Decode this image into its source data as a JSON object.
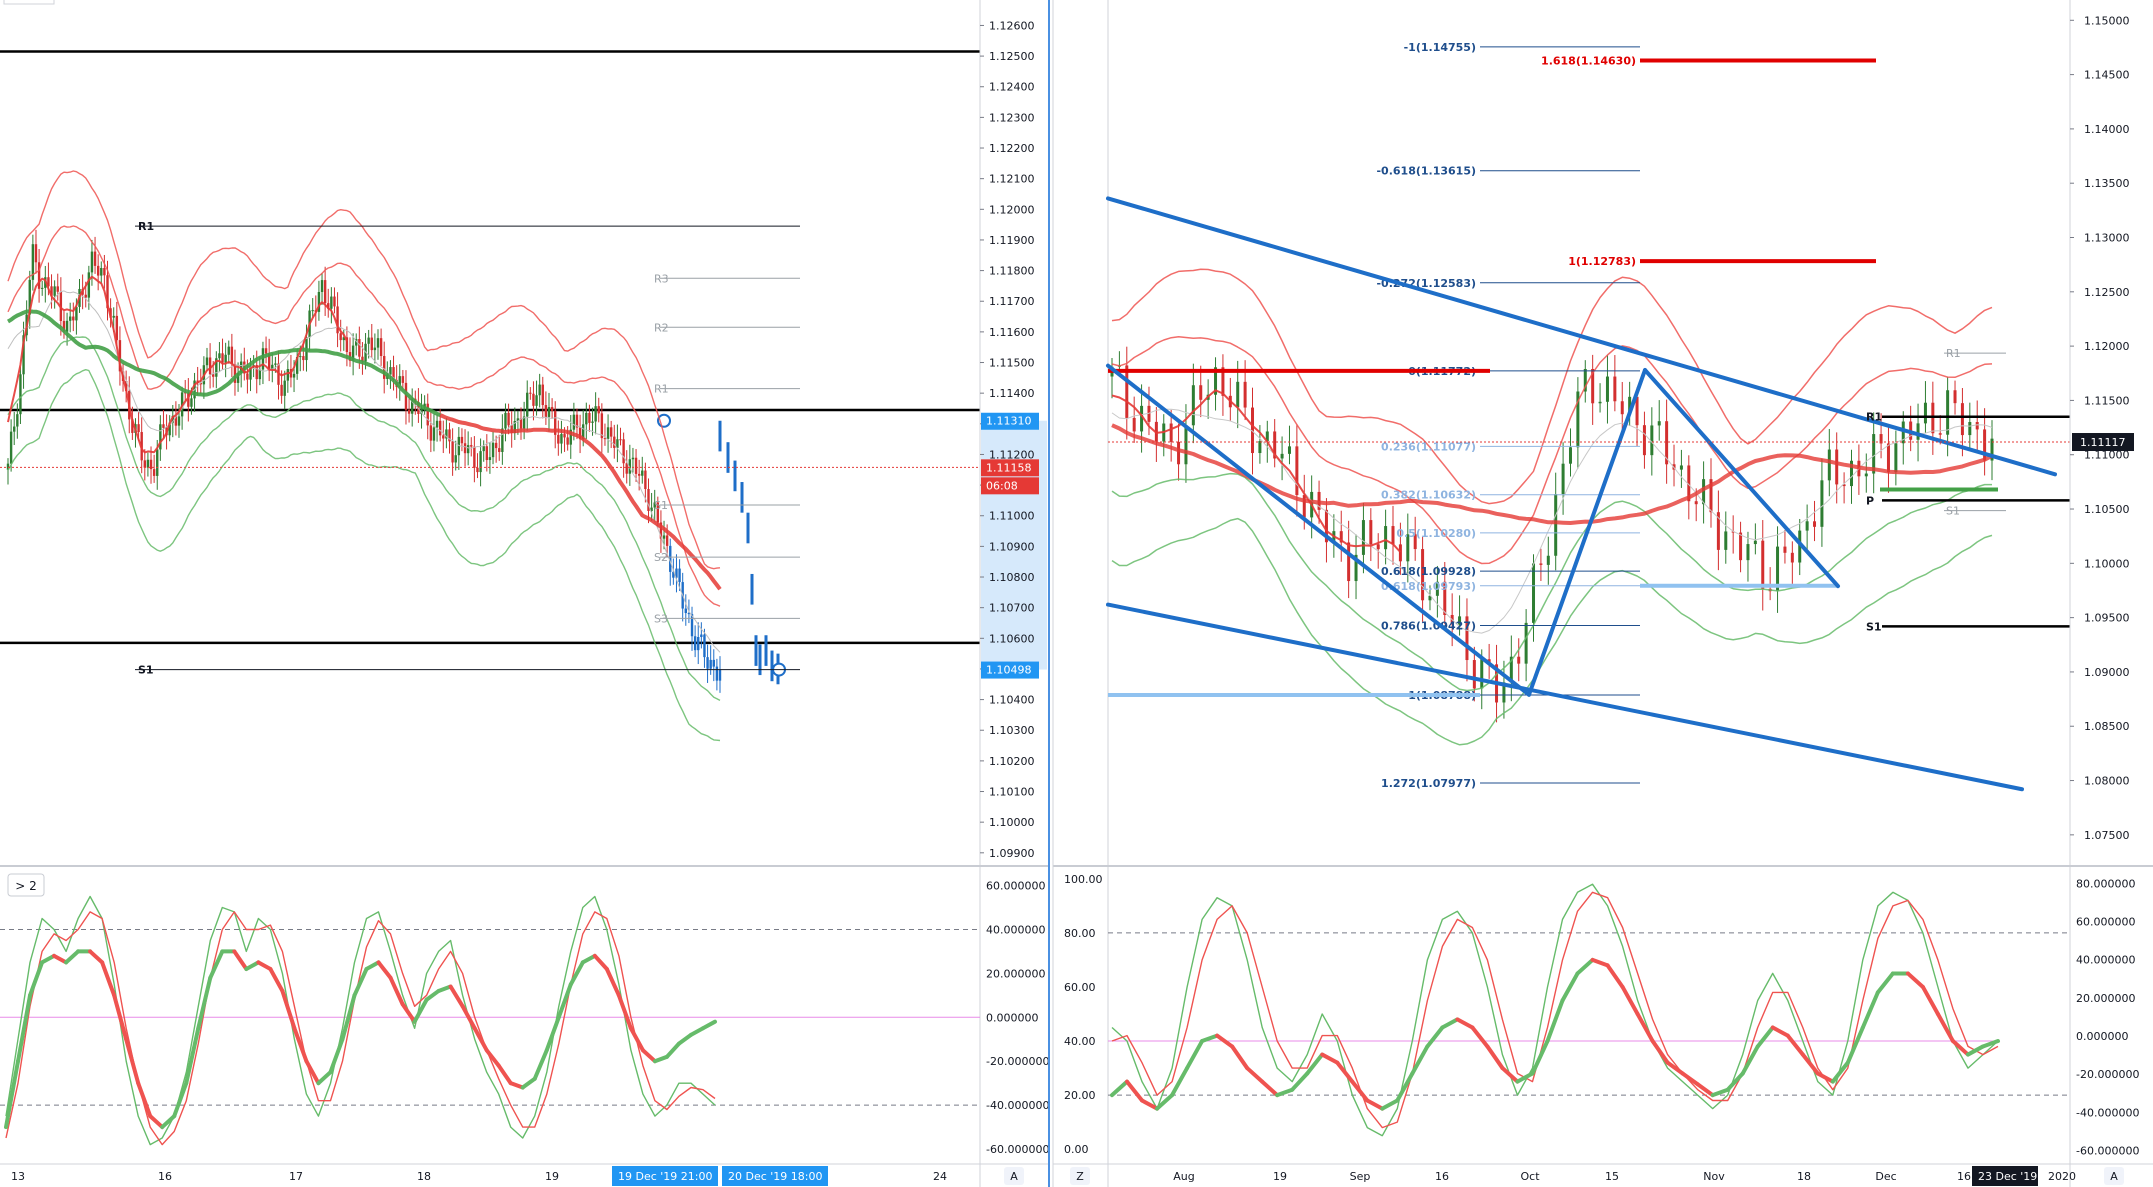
{
  "colors": {
    "up": "#2e7d32",
    "down": "#d32f2f",
    "bb_red": "#ef5350",
    "bb_green": "#66bb6a",
    "ma_red": "#e53935",
    "ma_green": "#43a047",
    "trend_blue": "#1e6ec8",
    "light_blue": "#90c2f0",
    "price_tag_blue": "#2196f3",
    "price_tag_red": "#e53935"
  },
  "left_chart": {
    "price_axis_ticks": [
      "1.12600",
      "1.12500",
      "1.12400",
      "1.12300",
      "1.12200",
      "1.12100",
      "1.12000",
      "1.11900",
      "1.11800",
      "1.11700",
      "1.11600",
      "1.11500",
      "1.11400",
      "1.11300",
      "1.11200",
      "1.11100",
      "1.11000",
      "1.10900",
      "1.10800",
      "1.10700",
      "1.10600",
      "1.10500",
      "1.10400",
      "1.10300",
      "1.10200",
      "1.10100",
      "1.10000",
      "1.09900"
    ],
    "price_tags": [
      {
        "text": "1.11310",
        "value": 1.1131,
        "color": "blue"
      },
      {
        "text": "1.11158",
        "value": 1.11158,
        "color": "red"
      },
      {
        "text": "06:08",
        "value": 1.11158,
        "color": "red"
      },
      {
        "text": "1.10498",
        "value": 1.10498,
        "color": "blue"
      }
    ],
    "time_labels": [
      "13",
      "16",
      "17",
      "18",
      "19",
      "24"
    ],
    "time_tags": [
      "19 Dec '19  21:00",
      "20 Dec '19  18:00"
    ],
    "pivots_bold": [
      {
        "label": "R1",
        "value": 1.11945
      },
      {
        "label": "S1",
        "value": 1.10498
      }
    ],
    "pivots_grey": [
      {
        "label": "R3",
        "value": 1.11775
      },
      {
        "label": "R2",
        "value": 1.11615
      },
      {
        "label": "R1",
        "value": 1.11415
      },
      {
        "label": "S1",
        "value": 1.11035
      },
      {
        "label": "S2",
        "value": 1.10865
      },
      {
        "label": "S3",
        "value": 1.10665
      }
    ],
    "horizontal_lines": [
      1.12515,
      1.11345,
      1.10585
    ],
    "corner_button": "A"
  },
  "left_oscillator": {
    "axis_ticks": [
      "60.000000",
      "40.000000",
      "20.000000",
      "0.000000",
      "-20.000000",
      "-40.000000",
      "-60.000000"
    ],
    "levels": [
      40,
      -40
    ],
    "zero_line": 0,
    "indicator_button": "> 2"
  },
  "right_chart": {
    "price_axis_ticks": [
      "1.15000",
      "1.14500",
      "1.14000",
      "1.13500",
      "1.13000",
      "1.12500",
      "1.12000",
      "1.11500",
      "1.11000",
      "1.10500",
      "1.10000",
      "1.09500",
      "1.09000",
      "1.08500",
      "1.08000",
      "1.07500"
    ],
    "price_tag": {
      "text": "1.11117",
      "value": 1.11117
    },
    "time_labels": [
      "Aug",
      "19",
      "Sep",
      "16",
      "Oct",
      "15",
      "Nov",
      "18",
      "Dec",
      "16",
      "2020"
    ],
    "time_tag": "23 Dec '19",
    "fib_levels": [
      {
        "label": "-1(1.14755)",
        "value": 1.14755,
        "style": "dark"
      },
      {
        "label": "1.618(1.14630)",
        "value": 1.1463,
        "style": "red"
      },
      {
        "label": "-0.618(1.13615)",
        "value": 1.13615,
        "style": "dark"
      },
      {
        "label": "1(1.12783)",
        "value": 1.12783,
        "style": "red"
      },
      {
        "label": "-0.272(1.12583)",
        "value": 1.12583,
        "style": "dark"
      },
      {
        "label": "0(1.11772)",
        "value": 1.11772,
        "style": "dark"
      },
      {
        "label": "0.236(1.11077)",
        "value": 1.11077,
        "style": "light"
      },
      {
        "label": "0.382(1.10632)",
        "value": 1.10632,
        "style": "light"
      },
      {
        "label": "0.5(1.10280)",
        "value": 1.1028,
        "style": "light"
      },
      {
        "label": "0.618(1.09928)",
        "value": 1.09928,
        "style": "dark"
      },
      {
        "label": "0.618(1.09793)",
        "value": 1.09793,
        "style": "light"
      },
      {
        "label": "0.786(1.09427)",
        "value": 1.09427,
        "style": "dark"
      },
      {
        "label": "1(1.08788)",
        "value": 1.08788,
        "style": "dark"
      },
      {
        "label": "1.272(1.07977)",
        "value": 1.07977,
        "style": "dark"
      }
    ],
    "pivots_bold": [
      {
        "label": "R1",
        "value": 1.1135
      },
      {
        "label": "P",
        "value": 1.1058
      },
      {
        "label": "S1",
        "value": 1.0942
      }
    ],
    "pivots_grey": [
      {
        "label": "R1",
        "value": 1.11935
      },
      {
        "label": "S1",
        "value": 1.10485
      }
    ],
    "corner_buttons": [
      "Z",
      "A"
    ]
  },
  "right_oscillator": {
    "left_axis_ticks": [
      "100.00",
      "80.00",
      "60.00",
      "40.00",
      "20.00",
      "0.00"
    ],
    "right_axis_ticks": [
      "80.000000",
      "60.000000",
      "40.000000",
      "20.000000",
      "0.000000",
      "-20.000000",
      "-40.000000",
      "-60.000000"
    ],
    "levels": [
      80,
      20
    ],
    "mid_line": 40
  },
  "chart_data": [
    {
      "type": "candlestick",
      "instrument_view": "left",
      "timeframe": "hourly",
      "ylim": [
        1.0987,
        1.1267
      ],
      "x_labels": [
        "13",
        "16",
        "17",
        "18",
        "19",
        "24"
      ],
      "price_path": [
        1.1115,
        1.1145,
        1.1185,
        1.1175,
        1.1172,
        1.116,
        1.1172,
        1.1182,
        1.1178,
        1.1155,
        1.1135,
        1.112,
        1.1115,
        1.113,
        1.1132,
        1.114,
        1.1145,
        1.115,
        1.1152,
        1.1148,
        1.1145,
        1.1152,
        1.1148,
        1.1142,
        1.115,
        1.1162,
        1.1176,
        1.1165,
        1.1155,
        1.1152,
        1.1158,
        1.115,
        1.1145,
        1.1138,
        1.1135,
        1.113,
        1.1126,
        1.1122,
        1.1122,
        1.1118,
        1.112,
        1.1128,
        1.113,
        1.1135,
        1.1142,
        1.113,
        1.1125,
        1.1128,
        1.1132,
        1.1131,
        1.1125,
        1.112,
        1.1115,
        1.1108,
        1.1095,
        1.1085,
        1.107,
        1.106,
        1.1052,
        1.105
      ],
      "last_price": 1.11158,
      "marked_high": 1.1131,
      "marked_low": 1.10498
    },
    {
      "type": "candlestick",
      "instrument_view": "right",
      "timeframe": "daily",
      "ylim": [
        1.0725,
        1.1515
      ],
      "x_labels": [
        "Aug",
        "19",
        "Sep",
        "16",
        "Oct",
        "15",
        "Nov",
        "18",
        "Dec",
        "16",
        "2020"
      ],
      "price_path": [
        1.1172,
        1.115,
        1.113,
        1.112,
        1.111,
        1.1125,
        1.1158,
        1.1172,
        1.1155,
        1.113,
        1.1115,
        1.1105,
        1.1085,
        1.1062,
        1.1035,
        1.102,
        1.1005,
        1.1015,
        1.103,
        1.102,
        1.1005,
        1.0985,
        1.0965,
        1.094,
        1.0915,
        1.0895,
        1.0879,
        1.0915,
        1.096,
        1.101,
        1.1075,
        1.1135,
        1.1172,
        1.1158,
        1.1145,
        1.1135,
        1.112,
        1.1105,
        1.1085,
        1.1065,
        1.1045,
        1.103,
        1.1015,
        1.1005,
        1.099,
        1.1002,
        1.1015,
        1.1055,
        1.108,
        1.1082,
        1.1088,
        1.1095,
        1.1108,
        1.1117,
        1.1125,
        1.1135,
        1.1142,
        1.113,
        1.112,
        1.1112
      ],
      "last_price": 1.11117
    },
    {
      "type": "line",
      "instrument_view": "left-oscillator",
      "ylim": [
        -65,
        68
      ],
      "levels": [
        40,
        -40
      ],
      "series": [
        {
          "values": [
            -45,
            -10,
            25,
            45,
            40,
            30,
            45,
            55,
            45,
            15,
            -20,
            -45,
            -58,
            -55,
            -45,
            -25,
            5,
            35,
            50,
            48,
            30,
            45,
            40,
            20,
            -10,
            -35,
            -45,
            -30,
            -5,
            25,
            45,
            48,
            30,
            10,
            -5,
            20,
            30,
            35,
            10,
            -10,
            -25,
            -35,
            -50,
            -55,
            -45,
            -25,
            5,
            30,
            50,
            55,
            40,
            15,
            -15,
            -35,
            -45,
            -40,
            -30,
            -30,
            -35,
            -40
          ]
        },
        {
          "values": [
            -55,
            -30,
            5,
            30,
            38,
            35,
            40,
            48,
            45,
            25,
            -5,
            -30,
            -50,
            -58,
            -52,
            -38,
            -12,
            18,
            40,
            48,
            40,
            40,
            42,
            30,
            5,
            -20,
            -38,
            -38,
            -20,
            8,
            32,
            44,
            38,
            20,
            5,
            10,
            22,
            30,
            20,
            0,
            -15,
            -28,
            -40,
            -50,
            -50,
            -35,
            -12,
            15,
            38,
            48,
            45,
            28,
            0,
            -22,
            -38,
            -42,
            -36,
            -32,
            -33,
            -37
          ]
        },
        {
          "values": [
            -50,
            -20,
            10,
            25,
            28,
            25,
            30,
            30,
            25,
            10,
            -10,
            -30,
            -45,
            -50,
            -45,
            -30,
            -5,
            18,
            30,
            30,
            22,
            25,
            22,
            12,
            -5,
            -20,
            -30,
            -25,
            -10,
            10,
            22,
            25,
            18,
            6,
            -2,
            8,
            12,
            14,
            5,
            -5,
            -15,
            -22,
            -30,
            -32,
            -28,
            -15,
            0,
            15,
            25,
            28,
            22,
            10,
            -5,
            -15,
            -20,
            -18,
            -12,
            -8,
            -5,
            -2
          ]
        }
      ]
    },
    {
      "type": "line",
      "instrument_view": "right-oscillator",
      "ylim": [
        -4,
        104
      ],
      "levels": [
        80,
        20
      ],
      "series": [
        {
          "values": [
            45,
            40,
            25,
            15,
            30,
            60,
            85,
            93,
            90,
            70,
            45,
            30,
            25,
            35,
            50,
            40,
            20,
            8,
            5,
            15,
            40,
            70,
            85,
            88,
            80,
            60,
            35,
            20,
            30,
            60,
            85,
            95,
            98,
            90,
            75,
            55,
            40,
            30,
            25,
            20,
            15,
            20,
            35,
            55,
            65,
            55,
            40,
            25,
            20,
            40,
            70,
            90,
            95,
            92,
            80,
            60,
            40,
            30,
            35,
            40
          ]
        },
        {
          "values": [
            40,
            42,
            32,
            20,
            25,
            45,
            70,
            85,
            90,
            80,
            60,
            40,
            30,
            30,
            42,
            42,
            30,
            15,
            8,
            10,
            28,
            55,
            75,
            85,
            82,
            70,
            48,
            28,
            25,
            45,
            70,
            88,
            95,
            93,
            82,
            65,
            48,
            35,
            28,
            22,
            18,
            18,
            28,
            45,
            58,
            58,
            45,
            30,
            22,
            30,
            55,
            78,
            90,
            92,
            85,
            70,
            52,
            38,
            35,
            38
          ]
        },
        {
          "values": [
            20,
            25,
            18,
            15,
            20,
            30,
            40,
            42,
            38,
            30,
            25,
            20,
            22,
            28,
            35,
            32,
            25,
            18,
            15,
            18,
            28,
            38,
            45,
            48,
            45,
            38,
            30,
            25,
            28,
            40,
            55,
            65,
            70,
            68,
            60,
            50,
            40,
            32,
            28,
            24,
            20,
            22,
            28,
            38,
            45,
            42,
            35,
            28,
            25,
            32,
            45,
            58,
            65,
            65,
            60,
            50,
            40,
            35,
            38,
            40
          ]
        }
      ]
    }
  ]
}
